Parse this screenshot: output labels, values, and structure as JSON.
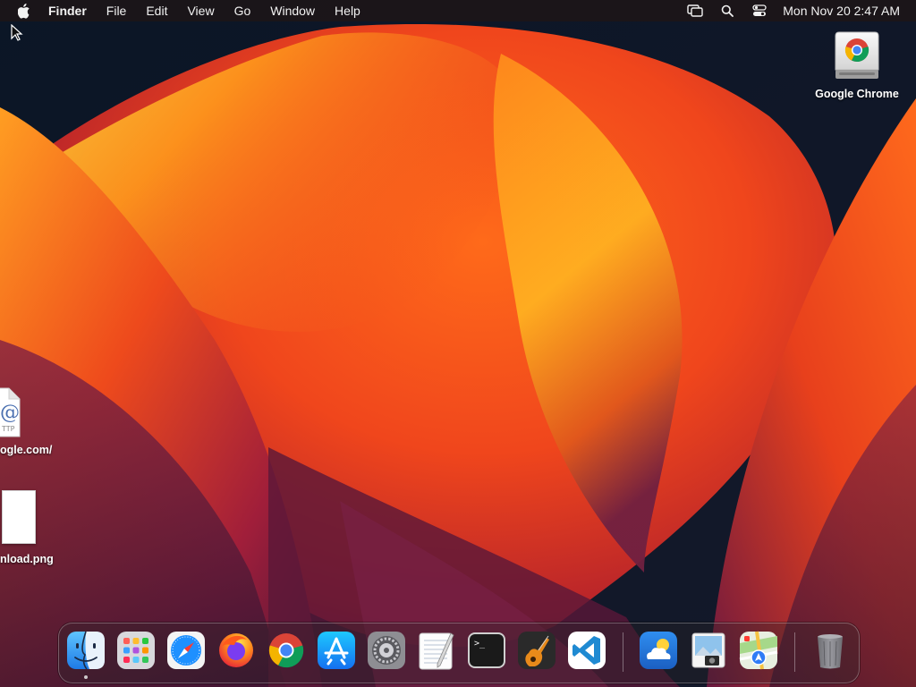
{
  "menubar": {
    "app_name": "Finder",
    "menus": [
      "File",
      "Edit",
      "View",
      "Go",
      "Window",
      "Help"
    ],
    "status_icons": [
      "screen-mirroring-icon",
      "search-icon",
      "control-center-icon"
    ],
    "clock": "Mon Nov 20  2:47 AM"
  },
  "desktop": {
    "icons": [
      {
        "label": "Google Chrome",
        "icon": "disk-image-icon"
      },
      {
        "label": "ogle.com/",
        "icon": "http-location-file-icon"
      },
      {
        "label": "nload.png",
        "icon": "png-file-icon"
      }
    ]
  },
  "dock": {
    "apps": [
      {
        "name": "Finder",
        "icon": "finder-icon",
        "running": true
      },
      {
        "name": "Launchpad",
        "icon": "launchpad-icon",
        "running": false
      },
      {
        "name": "Safari",
        "icon": "safari-icon",
        "running": false
      },
      {
        "name": "Firefox",
        "icon": "firefox-icon",
        "running": false
      },
      {
        "name": "Google Chrome",
        "icon": "chrome-icon",
        "running": false
      },
      {
        "name": "App Store",
        "icon": "app-store-icon",
        "running": false
      },
      {
        "name": "System Settings",
        "icon": "system-settings-icon",
        "running": false
      },
      {
        "name": "TextEdit",
        "icon": "textedit-icon",
        "running": false
      },
      {
        "name": "Terminal",
        "icon": "terminal-icon",
        "running": false
      },
      {
        "name": "GarageBand",
        "icon": "garageband-icon",
        "running": false
      },
      {
        "name": "Visual Studio Code",
        "icon": "vscode-icon",
        "running": false
      },
      {
        "name": "Weather",
        "icon": "weather-icon",
        "running": false
      },
      {
        "name": "Preview",
        "icon": "preview-icon",
        "running": false
      },
      {
        "name": "Maps",
        "icon": "maps-icon",
        "running": false
      },
      {
        "name": "Trash",
        "icon": "trash-icon",
        "running": false
      }
    ]
  },
  "colors": {
    "menubar_bg": "#1c1618",
    "wallpaper_dark": "#0e1a2c",
    "wallpaper_orange": "#f2661c",
    "wallpaper_yellow": "#ffb21a",
    "wallpaper_magenta": "#7a1e4e"
  }
}
